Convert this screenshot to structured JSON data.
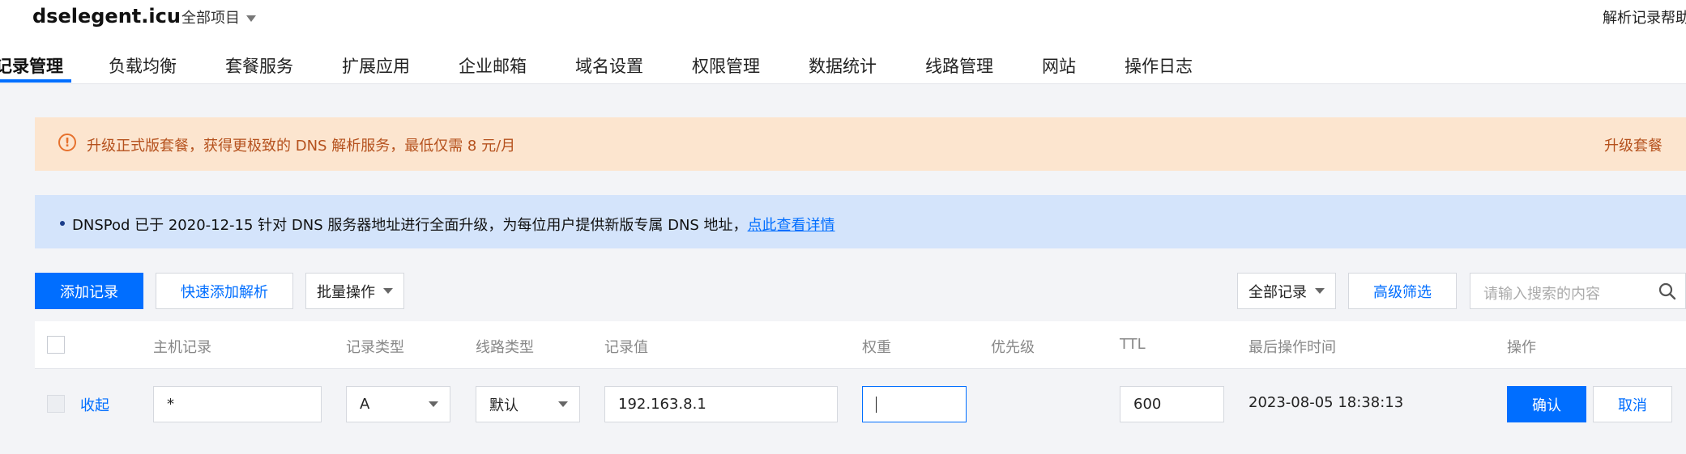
{
  "header": {
    "domain": "dselegent.icu",
    "project_selector": "全部项目",
    "help_link": "解析记录帮助"
  },
  "tabs": [
    {
      "label": "记录管理",
      "active": true
    },
    {
      "label": "负载均衡"
    },
    {
      "label": "套餐服务"
    },
    {
      "label": "扩展应用"
    },
    {
      "label": "企业邮箱"
    },
    {
      "label": "域名设置"
    },
    {
      "label": "权限管理"
    },
    {
      "label": "数据统计"
    },
    {
      "label": "线路管理"
    },
    {
      "label": "网站"
    },
    {
      "label": "操作日志"
    }
  ],
  "upgrade_banner": {
    "icon": "warning-circle-icon",
    "text": "升级正式版套餐，获得更极致的 DNS 解析服务，最低仅需 8 元/月",
    "action": "升级套餐"
  },
  "notice": {
    "text": "DNSPod 已于 2020-12-15 针对 DNS 服务器地址进行全面升级，为每位用户提供新版专属 DNS 地址，",
    "link": "点此查看详情"
  },
  "toolbar": {
    "add_record": "添加记录",
    "quick_add": "快速添加解析",
    "batch_ops": "批量操作",
    "record_filter": "全部记录",
    "advanced_filter": "高级筛选",
    "search_placeholder": "请输入搜索的内容"
  },
  "table": {
    "columns": [
      "主机记录",
      "记录类型",
      "线路类型",
      "记录值",
      "权重",
      "优先级",
      "TTL",
      "最后操作时间",
      "操作"
    ],
    "edit_row": {
      "collapse": "收起",
      "host": "*",
      "type": "A",
      "line": "默认",
      "value": "192.163.8.1",
      "weight": "",
      "ttl": "600",
      "last_modified": "2023-08-05 18:38:13",
      "confirm": "确认",
      "cancel": "取消"
    }
  },
  "colors": {
    "primary": "#006eff",
    "warning_bg": "#fce5cf",
    "warning_text": "#b5511d",
    "notice_bg": "#d4e4fb"
  }
}
